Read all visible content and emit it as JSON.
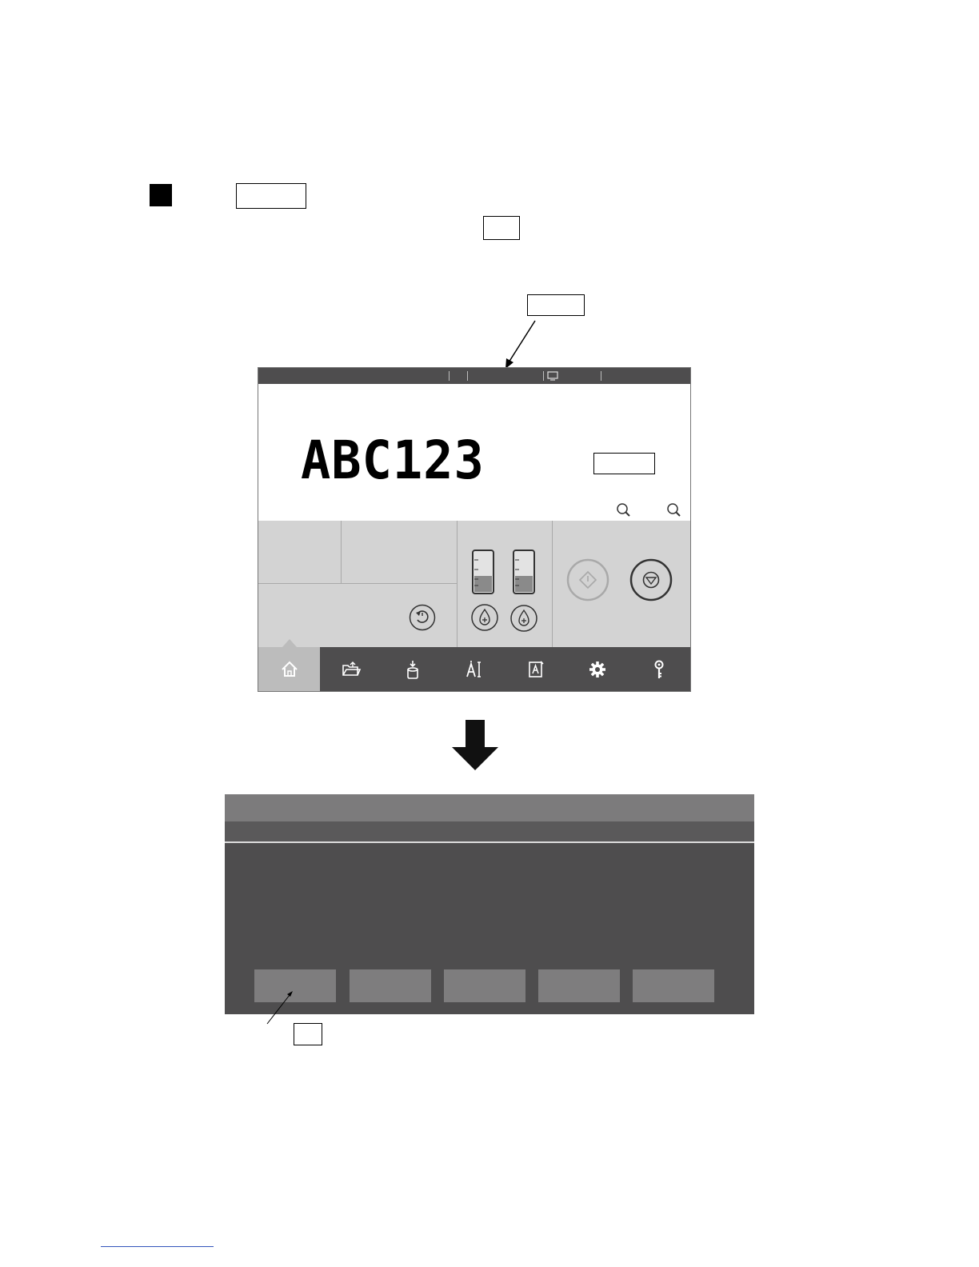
{
  "screen1": {
    "print_preview": "ABC123",
    "nav_items": [
      {
        "icon": "home-icon",
        "active": true
      },
      {
        "icon": "folder-open-icon"
      },
      {
        "icon": "ink-bottle-icon"
      },
      {
        "icon": "text-edit-icon"
      },
      {
        "icon": "message-edit-icon"
      },
      {
        "icon": "gear-icon"
      },
      {
        "icon": "key-icon"
      }
    ],
    "ink_level_1": 0.4,
    "ink_level_2": 0.4
  },
  "screen2": {
    "buttons": 5
  },
  "colors": {
    "dark_bar": "#4e4d4e",
    "panel_gray": "#d3d3d3",
    "dialog_title": "#7c7b7c",
    "dialog_button": "#7e7d7e"
  }
}
